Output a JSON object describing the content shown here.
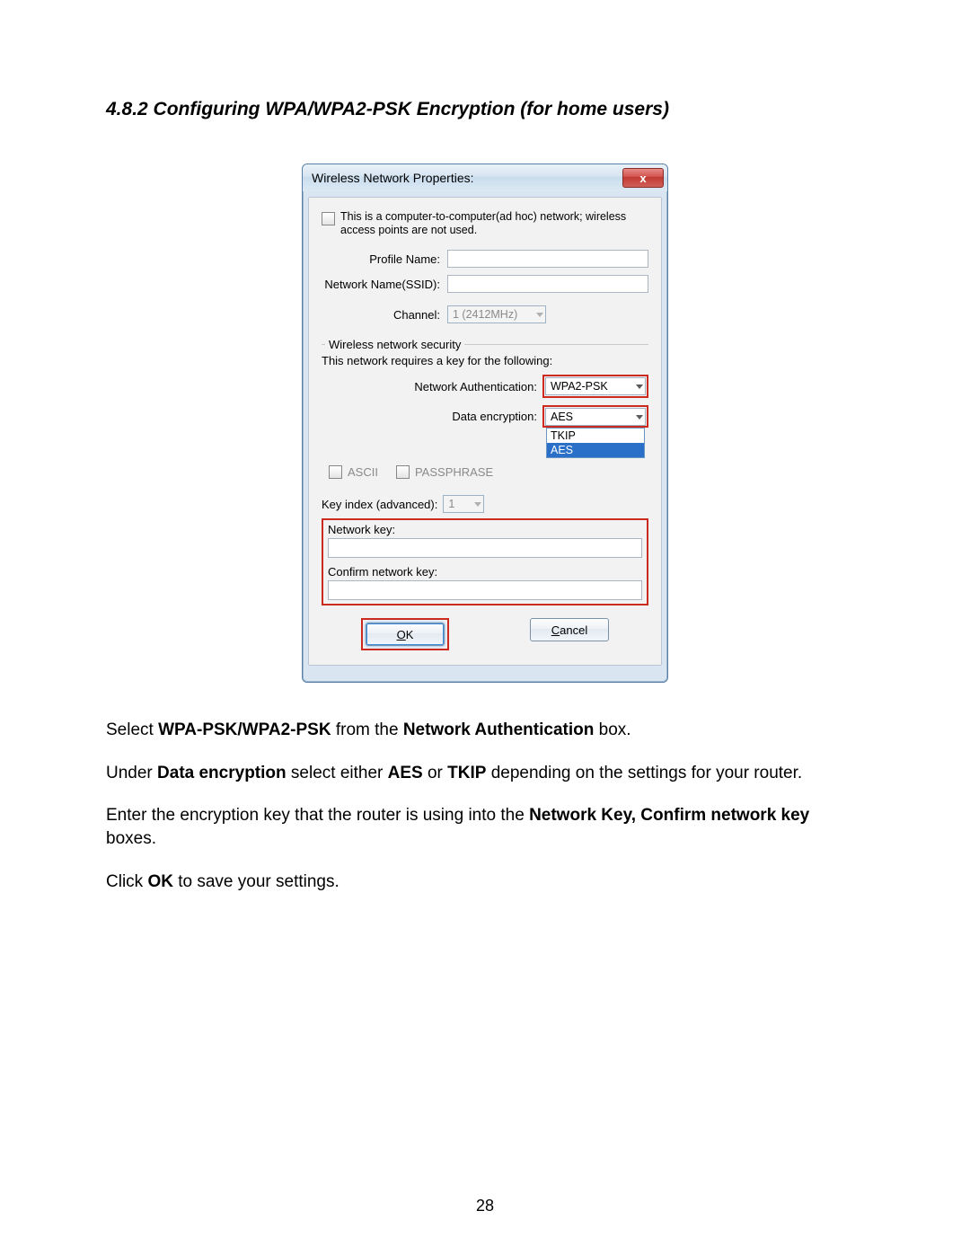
{
  "heading": "4.8.2 Configuring WPA/WPA2-PSK Encryption (for home users)",
  "dialog": {
    "title": "Wireless Network Properties:",
    "close_glyph": "x",
    "adhoc_text": "This is a computer-to-computer(ad hoc) network; wireless access points are not used.",
    "profile_name_label": "Profile Name:",
    "profile_name_value": "",
    "ssid_label": "Network Name(SSID):",
    "ssid_value": "",
    "channel_label": "Channel:",
    "channel_value": "1 (2412MHz)",
    "security_group_label": "Wireless network security",
    "security_intro": "This network requires a key for the following:",
    "auth_label": "Network Authentication:",
    "auth_value": "WPA2-PSK",
    "enc_label": "Data encryption:",
    "enc_value": "AES",
    "enc_options": {
      "opt0": "TKIP",
      "opt1": "AES"
    },
    "ascii_label": "ASCII",
    "passphrase_label": "PASSPHRASE",
    "keyindex_label": "Key index (advanced):",
    "keyindex_value": "1",
    "netkey_label": "Network key:",
    "netkey_value": "",
    "confirm_label": "Confirm network key:",
    "confirm_value": "",
    "ok_label": "OK",
    "cancel_label": "Cancel"
  },
  "para1_a": "Select ",
  "para1_b": "WPA-PSK/WPA2-PSK",
  "para1_c": " from the ",
  "para1_d": "Network Authentication",
  "para1_e": " box.",
  "para2_a": "Under ",
  "para2_b": "Data encryption",
  "para2_c": " select either ",
  "para2_d": "AES",
  "para2_e": " or ",
  "para2_f": "TKIP",
  "para2_g": " depending on the settings for your router.",
  "para3_a": "Enter the encryption key that the router is using into the ",
  "para3_b": "Network Key, Confirm network key",
  "para3_c": " boxes.",
  "para4_a": "Click ",
  "para4_b": "OK",
  "para4_c": " to save your settings.",
  "page_number": "28"
}
